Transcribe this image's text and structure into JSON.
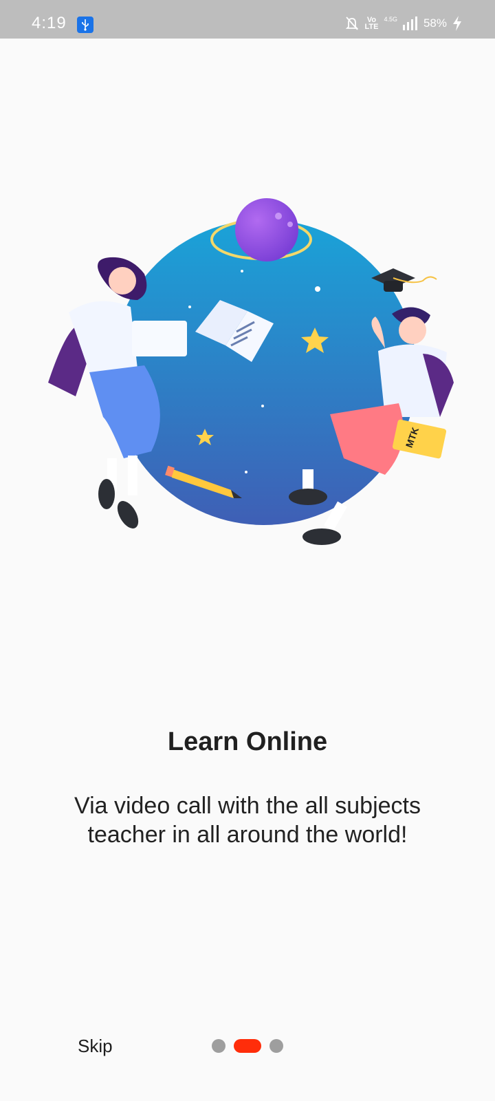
{
  "status_bar": {
    "time": "4:19",
    "volte_top": "Vo",
    "volte_bottom": "LTE",
    "network": "4.5G",
    "battery": "58%"
  },
  "onboarding": {
    "title": "Learn Online",
    "description_line1": "Via video call with the all subjects",
    "description_line2": "teacher in all around the world!",
    "book_label": "MTK"
  },
  "footer": {
    "skip_label": "Skip",
    "pages": 3,
    "current_page": 2
  },
  "colors": {
    "accent": "#ff2d0a",
    "inactive_dot": "#9e9e9e",
    "status_bar_bg": "#bdbdbd"
  }
}
